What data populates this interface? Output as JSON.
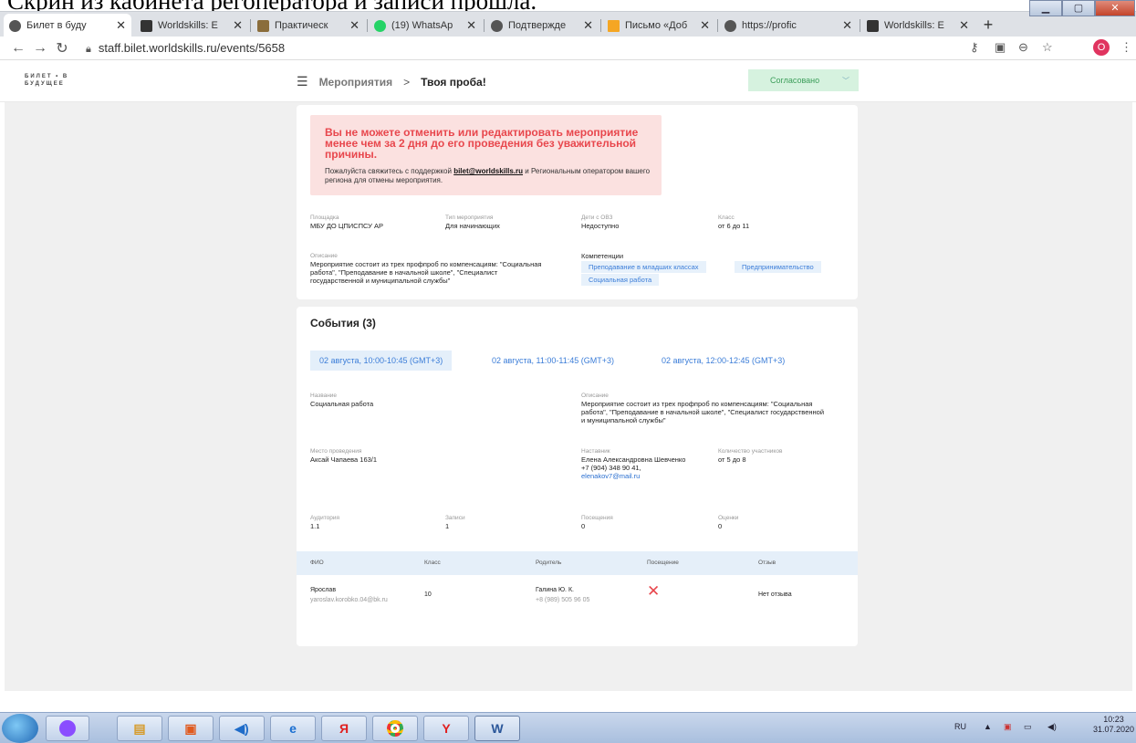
{
  "caption": "Скрин из кабинета регоператора и записи прошла.",
  "tabs": [
    {
      "label": "Билет в буду",
      "active": true
    },
    {
      "label": "Worldskills: E"
    },
    {
      "label": "Практическ"
    },
    {
      "label": "(19) WhatsAp"
    },
    {
      "label": "Подтвержде"
    },
    {
      "label": "Письмо «Доб"
    },
    {
      "label": "https://profic"
    },
    {
      "label": "Worldskills: E"
    }
  ],
  "address": {
    "url": "staff.bilet.worldskills.ru/events/5658",
    "avatar": "O"
  },
  "logo": [
    "БИЛЕТ • В",
    "БУДУЩЕЕ"
  ],
  "breadcrumb": {
    "item1": "Мероприятия",
    "sep": ">",
    "current": "Твоя проба!"
  },
  "status": "Согласовано",
  "alert": {
    "heading": "Вы не можете отменить или редактировать мероприятие менее чем за 2 дня до его проведения без уважительной причины.",
    "text1": "Пожалуйста свяжитесь с поддержкой",
    "email": "bilet@worldskills.ru",
    "text2": "и Региональным оператором вашего региона для отмены мероприятия."
  },
  "info": {
    "venue": {
      "label": "Площадка",
      "value": "МБУ ДО ЦПИСПСУ АР"
    },
    "type": {
      "label": "Тип мероприятия",
      "value": "Для начинающих"
    },
    "ovz": {
      "label": "Дети с ОВЗ",
      "value": "Недоступно"
    },
    "grade": {
      "label": "Класс",
      "value": "от 6 до 11"
    },
    "description": {
      "label": "Описание",
      "value": "Мероприятие состоит из трех профпроб по компенсациям: \"Социальная работа\", \"Преподавание в начальной школе\", \"Специалист государственной и муниципальной службы\""
    },
    "competencies": {
      "label": "Компетенции",
      "items": [
        "Преподавание в младших классах",
        "Предпринимательство",
        "Социальная работа"
      ]
    }
  },
  "events": {
    "title": "События (3)",
    "tabs": [
      "02 августа, 10:00-10:45 (GMT+3)",
      "02 августа, 11:00-11:45 (GMT+3)",
      "02 августа, 12:00-12:45 (GMT+3)"
    ],
    "name": {
      "label": "Название",
      "value": "Социальная работа"
    },
    "description": {
      "label": "Описание",
      "value": "Мероприятие состоит из трех профпроб по компенсациям: \"Социальная работа\", \"Преподавание в начальной школе\", \"Специалист государственной и муниципальной службы\""
    },
    "place": {
      "label": "Место проведения",
      "value": "Аксай Чапаева 163/1"
    },
    "mentor": {
      "label": "Наставник",
      "name": "Елена Александровна Шевченко",
      "phone": "+7 (904) 348 90 41,",
      "email": "elenakov7@mail.ru"
    },
    "participants": {
      "label": "Количество участников",
      "value": "от 5 до 8"
    },
    "room": {
      "label": "Аудитория",
      "value": "1.1"
    },
    "records": {
      "label": "Записи",
      "value": "1"
    },
    "visits": {
      "label": "Посещения",
      "value": "0"
    },
    "ratings": {
      "label": "Оценки",
      "value": "0"
    }
  },
  "table": {
    "headers": [
      "ФИО",
      "Класс",
      "Родитель",
      "Посещение",
      "Отзыв"
    ],
    "rows": [
      {
        "name": "Ярослав",
        "email": "yaroslav.korobko.04@bk.ru",
        "grade": "10",
        "parent": "Галина Ю. К.",
        "parent_phone": "+8 (989) 505 96 05",
        "visit_icon": "cross-icon",
        "review": "Нет отзыва"
      }
    ]
  },
  "taskbar": {
    "lang": "RU",
    "time": "10:23",
    "date": "31.07.2020"
  }
}
